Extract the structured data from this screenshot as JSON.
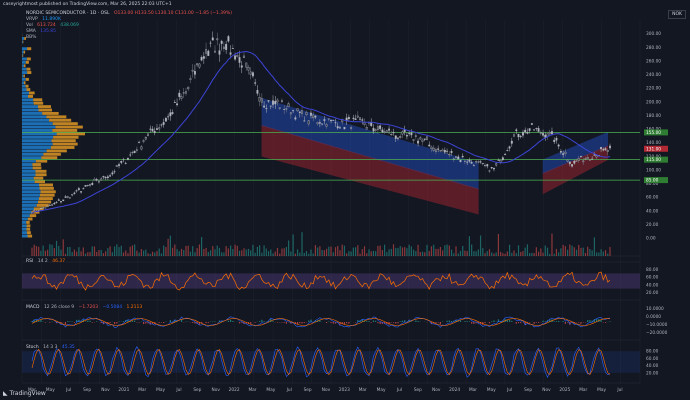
{
  "header": {
    "published": "caseyrightmost published on TradingView.com, Mar 26, 2025 22:03 UTC+1",
    "symbol_line": "NORDIC SEMICONDUCTOR · 1D · OSL",
    "ohlc": "O133.00 H133.50 L130.10 C131.00 −1.85 (−1.39%)",
    "vrvp_label": "VRVP",
    "vrvp_value": "11.890K",
    "vol_label": "Vol",
    "vol_value": "613.724",
    "vol_value2": "438.069",
    "sma_label": "SMA",
    "sma_value": "135.85",
    "bb_label": "BB%"
  },
  "currency": "NOK",
  "indicators": {
    "rsi": {
      "label": "RSI",
      "params": "14 2",
      "value": "46.37"
    },
    "macd": {
      "label": "MACD",
      "params": "12 26 close 9",
      "v1": "−1.7203",
      "v2": "−0.5084",
      "v3": "1.2113"
    },
    "stoch": {
      "label": "Stoch",
      "params": "14 3 3",
      "value": "45.35"
    }
  },
  "price_axis": [
    "300.00",
    "280.00",
    "260.00",
    "240.00",
    "220.00",
    "200.00",
    "180.00",
    "160.00",
    "140.00",
    "120.00",
    "100.00",
    "80.00",
    "60.00",
    "40.00",
    "20.00",
    "0.00"
  ],
  "price_tags": [
    {
      "value": "155.00",
      "kind": "green"
    },
    {
      "value": "131.00",
      "kind": "red"
    },
    {
      "value": "115.00",
      "kind": "green"
    },
    {
      "value": "85.00",
      "kind": "green"
    }
  ],
  "rsi_axis": [
    "80.00",
    "60.00",
    "40.00",
    "20.00"
  ],
  "macd_axis": [
    "10.0000",
    "0.0000",
    "−10.0000",
    "−20.0000"
  ],
  "stoch_axis": [
    "80.00",
    "60.00",
    "40.00",
    "20.00"
  ],
  "time_axis": [
    "Mar",
    "May",
    "Jul",
    "Sep",
    "Nov",
    "2021",
    "Mar",
    "May",
    "Jul",
    "Sep",
    "Nov",
    "2022",
    "Mar",
    "May",
    "Jul",
    "Sep",
    "Nov",
    "2023",
    "Mar",
    "May",
    "Jul",
    "Sep",
    "Nov",
    "2024",
    "Mar",
    "May",
    "Jul",
    "Sep",
    "Nov",
    "2025",
    "Mar",
    "May",
    "Jul"
  ],
  "footer": "TradingView",
  "colors": {
    "bg": "#131722",
    "up": "#b2b5be",
    "down": "#d1d4dc",
    "ma": "#3c44d6",
    "bull_channel": "#2962ff",
    "bear_channel": "#b22833",
    "support": "#4caf50",
    "rsi": "#ff6f00",
    "rsi_band": "#7e57c2",
    "vrvp_up": "#2196f3",
    "vrvp_down": "#f9a825"
  },
  "chart_data": {
    "type": "candlestick",
    "title": "NORDIC SEMICONDUCTOR · 1D · OSL",
    "ylim": [
      0,
      320
    ],
    "dates": [
      "2020-03",
      "2020-05",
      "2020-07",
      "2020-09",
      "2020-11",
      "2021-01",
      "2021-03",
      "2021-05",
      "2021-07",
      "2021-09",
      "2021-11",
      "2022-01",
      "2022-03",
      "2022-05",
      "2022-07",
      "2022-09",
      "2022-11",
      "2023-01",
      "2023-03",
      "2023-05",
      "2023-07",
      "2023-09",
      "2023-11",
      "2024-01",
      "2024-03",
      "2024-05",
      "2024-07",
      "2024-09",
      "2024-11",
      "2025-01",
      "2025-03"
    ],
    "close": [
      38,
      48,
      62,
      78,
      92,
      118,
      150,
      175,
      215,
      275,
      290,
      255,
      200,
      195,
      180,
      172,
      168,
      170,
      160,
      150,
      148,
      130,
      120,
      110,
      100,
      150,
      160,
      150,
      110,
      120,
      131
    ],
    "support_levels": [
      155,
      115,
      85
    ],
    "last_close": 131
  }
}
